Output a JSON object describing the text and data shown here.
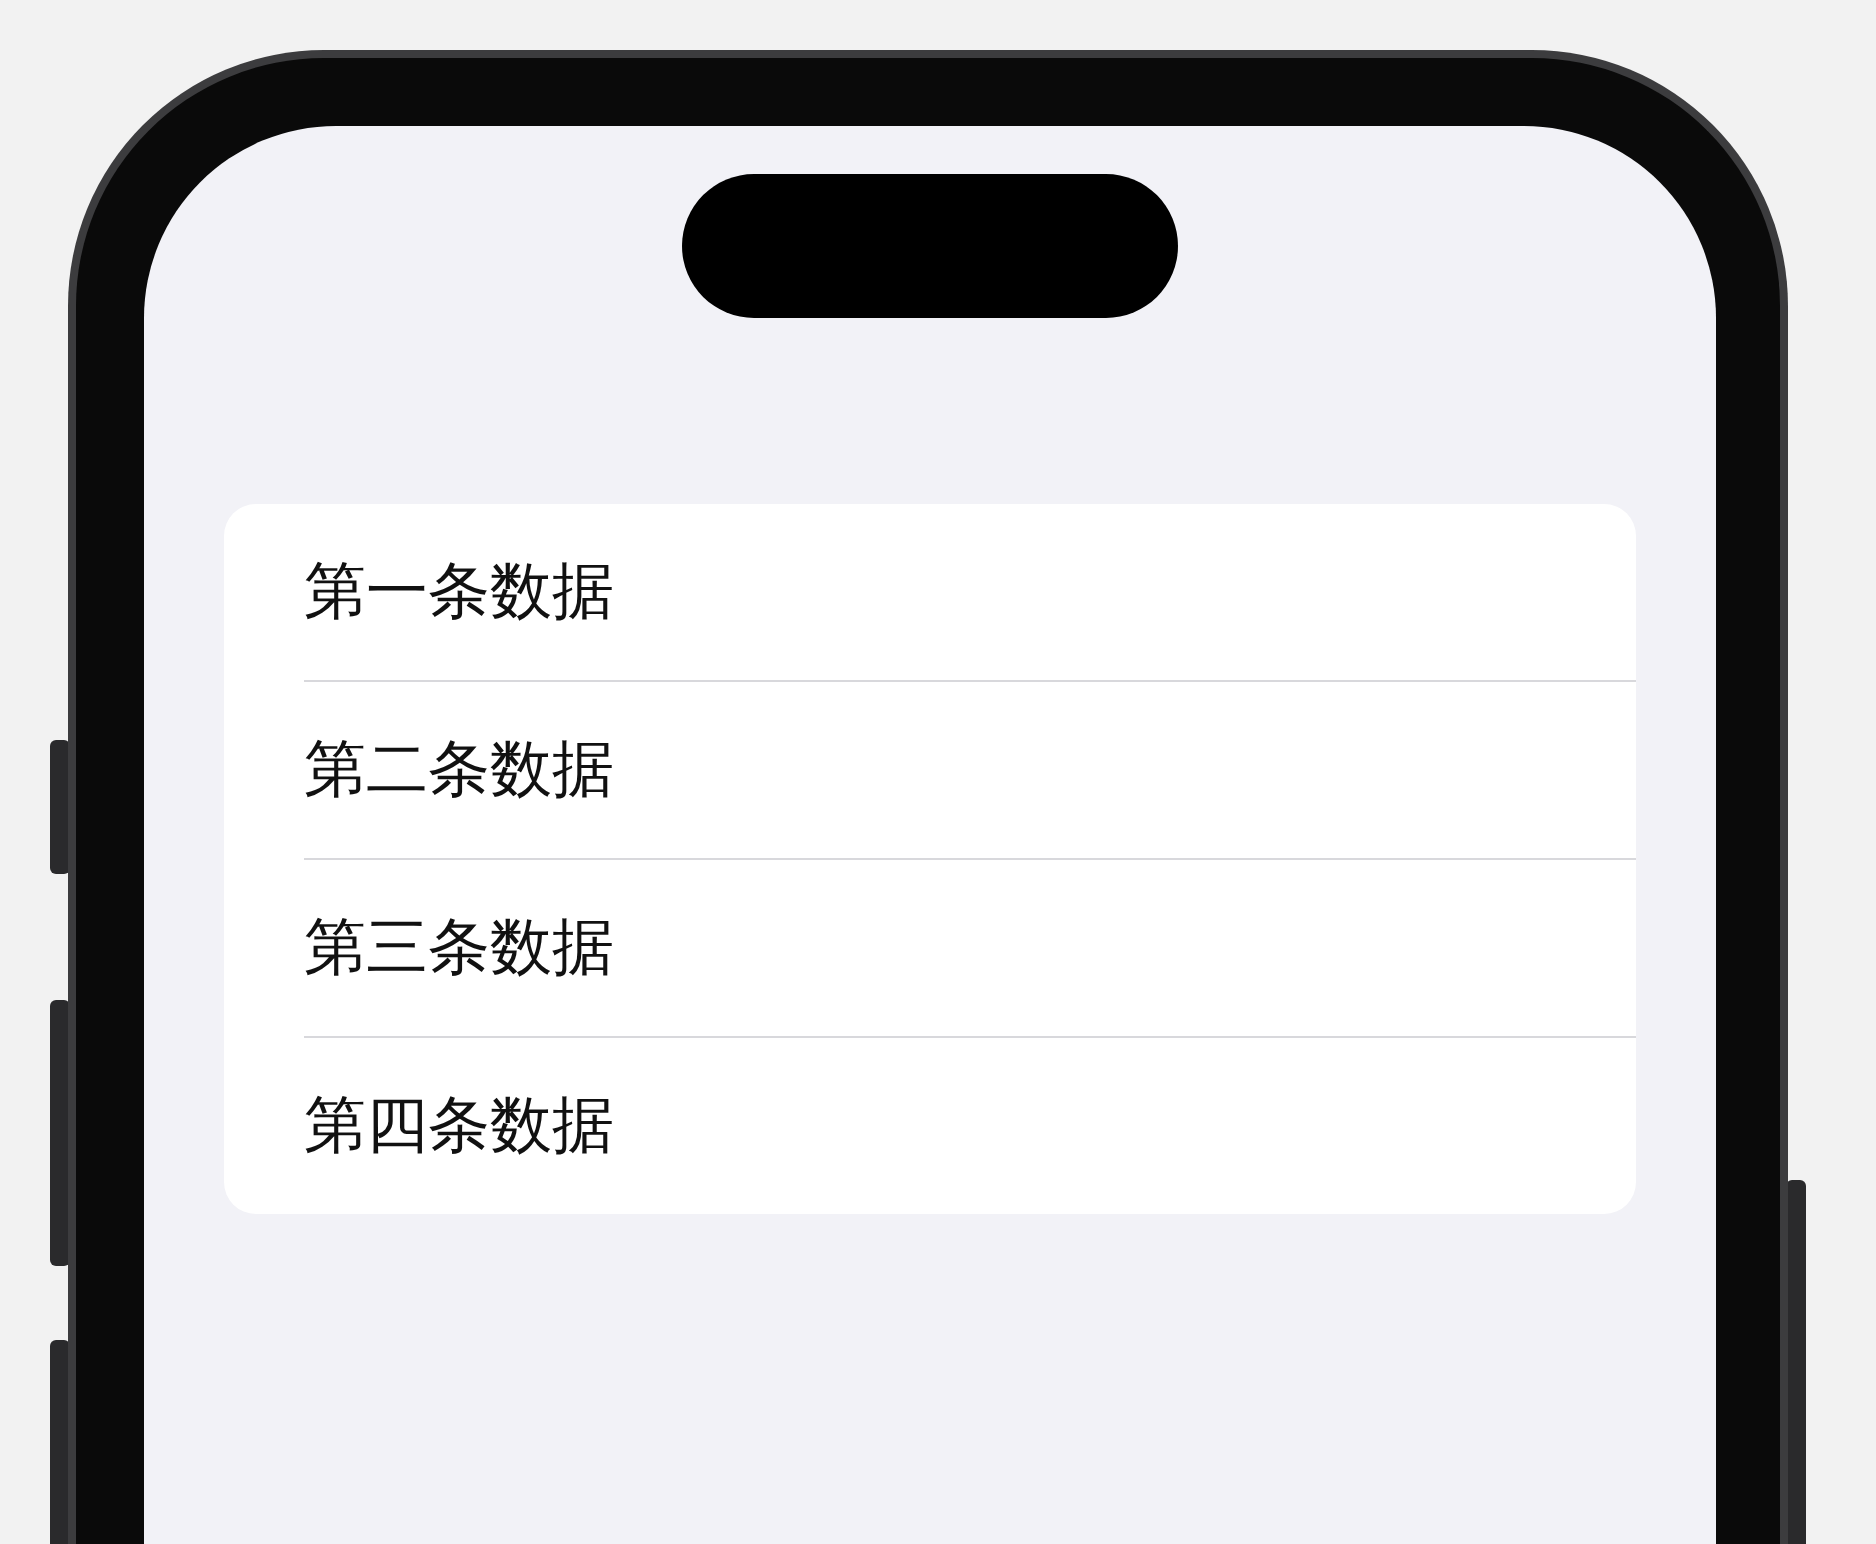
{
  "list": {
    "items": [
      {
        "label": "第一条数据"
      },
      {
        "label": "第二条数据"
      },
      {
        "label": "第三条数据"
      },
      {
        "label": "第四条数据"
      }
    ]
  }
}
